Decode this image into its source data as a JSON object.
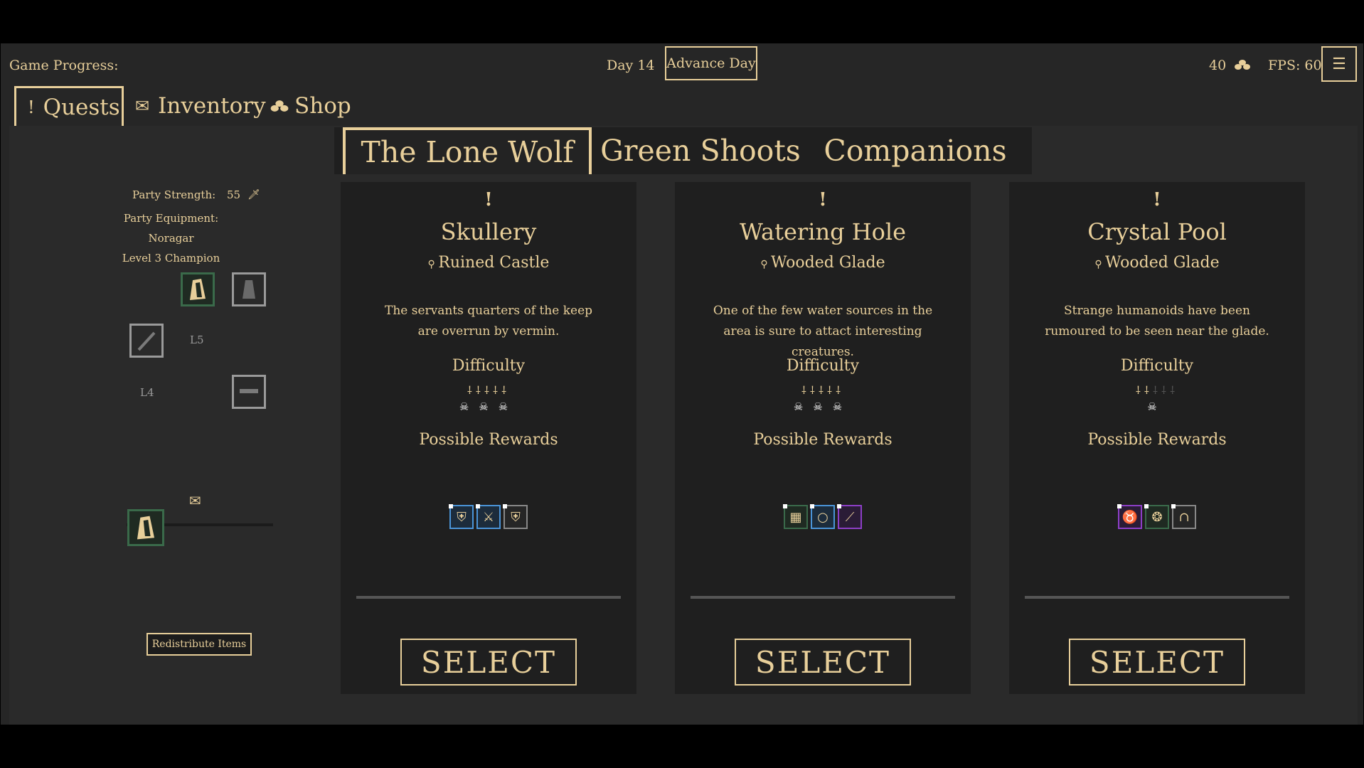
{
  "topbar": {
    "game_progress_label": "Game Progress:",
    "day": "Day 14",
    "advance_day_label": "Advance Day",
    "gold": "40",
    "gold_icon": "coins-icon",
    "fps": "FPS: 60",
    "menu_icon": "hamburger-menu-icon"
  },
  "main_tabs": [
    {
      "label": "Quests",
      "icon": "exclamation-icon",
      "active": true
    },
    {
      "label": "Inventory",
      "icon": "envelope-icon",
      "active": false
    },
    {
      "label": "Shop",
      "icon": "coins-icon",
      "active": false
    }
  ],
  "quest_tabs": [
    {
      "label": "The Lone Wolf",
      "active": true
    },
    {
      "label": "Green Shoots",
      "active": false
    },
    {
      "label": "Companions",
      "active": false
    }
  ],
  "party": {
    "strength_label": "Party Strength:",
    "strength_value": "55",
    "equipment_label": "Party Equipment:",
    "member_name": "Noragar",
    "member_level": "Level 3 Champion",
    "slot_labels": {
      "l5": "L5",
      "l4": "L4"
    },
    "redistribute_label": "Redistribute Items"
  },
  "quests": [
    {
      "title": "Skullery",
      "location": "Ruined Castle",
      "description": "The servants quarters of the keep are overrun by vermin.",
      "difficulty_label": "Difficulty",
      "difficulty_ranks": 5,
      "difficulty_max": 5,
      "skulls": 3,
      "rewards_label": "Possible Rewards",
      "rewards": [
        {
          "icon": "chest-armor-icon",
          "rarity": "blue"
        },
        {
          "icon": "sword-icon",
          "rarity": "blue"
        },
        {
          "icon": "chest-armor-icon",
          "rarity": "common"
        }
      ],
      "select_label": "SELECT"
    },
    {
      "title": "Watering Hole",
      "location": "Wooded Glade",
      "description": "One of the few water sources in the area is sure to attact interesting creatures.",
      "difficulty_label": "Difficulty",
      "difficulty_ranks": 5,
      "difficulty_max": 5,
      "skulls": 3,
      "rewards_label": "Possible Rewards",
      "rewards": [
        {
          "icon": "mail-armor-icon",
          "rarity": "green"
        },
        {
          "icon": "ring-icon",
          "rarity": "blue"
        },
        {
          "icon": "staff-icon",
          "rarity": "purple"
        }
      ],
      "select_label": "SELECT"
    },
    {
      "title": "Crystal Pool",
      "location": "Wooded Glade",
      "description": "Strange humanoids have been rumoured to be seen near the glade.",
      "difficulty_label": "Difficulty",
      "difficulty_ranks": 2,
      "difficulty_max": 5,
      "skulls": 1,
      "rewards_label": "Possible Rewards",
      "rewards": [
        {
          "icon": "horned-helmet-icon",
          "rarity": "purple"
        },
        {
          "icon": "amulet-icon",
          "rarity": "green"
        },
        {
          "icon": "cloak-icon",
          "rarity": "common"
        }
      ],
      "select_label": "SELECT"
    }
  ]
}
